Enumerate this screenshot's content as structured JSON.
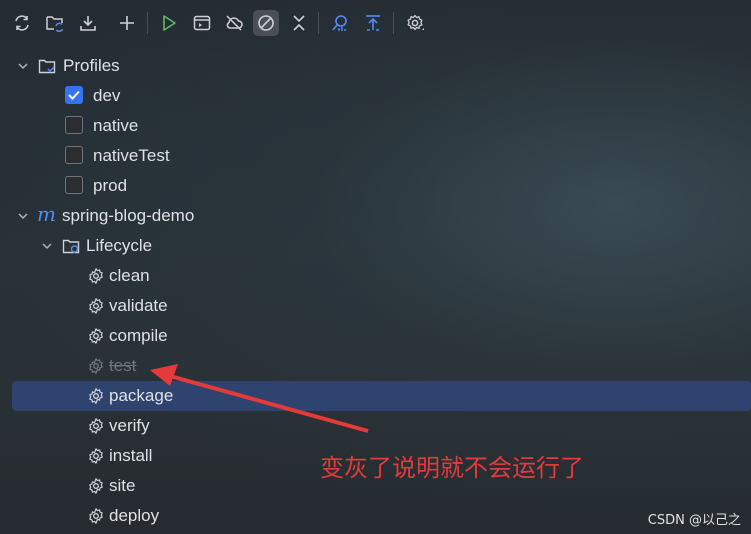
{
  "toolbar": {
    "icons": [
      "reload-icon",
      "reload-folder-icon",
      "download-icon",
      "add-icon",
      "run-icon",
      "execute-goal-icon",
      "offline-icon",
      "skip-tests-icon",
      "collapse-icon",
      "analyze-dependencies-icon",
      "show-dependencies-icon",
      "settings-icon"
    ]
  },
  "tree": {
    "profiles_label": "Profiles",
    "profiles": [
      {
        "label": "dev",
        "checked": true
      },
      {
        "label": "native",
        "checked": false
      },
      {
        "label": "nativeTest",
        "checked": false
      },
      {
        "label": "prod",
        "checked": false
      }
    ],
    "project_label": "spring-blog-demo",
    "lifecycle_label": "Lifecycle",
    "goals": [
      {
        "label": "clean",
        "skipped": false,
        "selected": false
      },
      {
        "label": "validate",
        "skipped": false,
        "selected": false
      },
      {
        "label": "compile",
        "skipped": false,
        "selected": false
      },
      {
        "label": "test",
        "skipped": true,
        "selected": false
      },
      {
        "label": "package",
        "skipped": false,
        "selected": true
      },
      {
        "label": "verify",
        "skipped": false,
        "selected": false
      },
      {
        "label": "install",
        "skipped": false,
        "selected": false
      },
      {
        "label": "site",
        "skipped": false,
        "selected": false
      },
      {
        "label": "deploy",
        "skipped": false,
        "selected": false
      }
    ]
  },
  "annotation": {
    "text": "变灰了说明就不会运行了",
    "color": "#e53a3a"
  },
  "watermark": "CSDN @以己之",
  "colors": {
    "selection": "#2e436e",
    "checkbox_on": "#3574f0",
    "run_green": "#5fb865",
    "accent_blue": "#548af7"
  }
}
